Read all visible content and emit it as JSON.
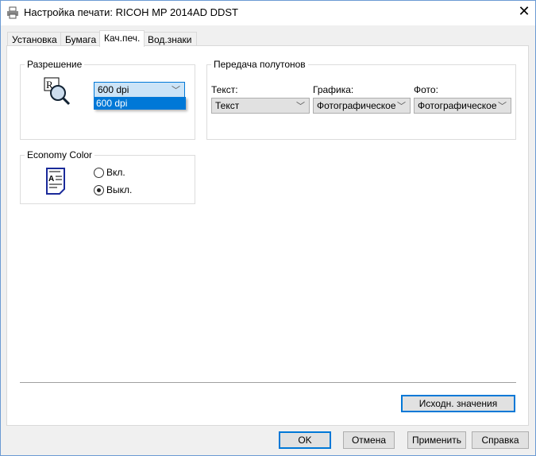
{
  "window": {
    "title": "Настройка печати: RICOH MP 2014AD DDST",
    "close": "✕"
  },
  "tabs": [
    {
      "label": "Установка"
    },
    {
      "label": "Бумага"
    },
    {
      "label": "Кач.печ.",
      "selected": true
    },
    {
      "label": "Вод.знаки"
    }
  ],
  "resolution": {
    "legend": "Разрешение",
    "value": "600 dpi",
    "options": [
      "600 dpi"
    ]
  },
  "halftone": {
    "legend": "Передача полутонов",
    "text": {
      "label": "Текст:",
      "value": "Текст"
    },
    "graphics": {
      "label": "Графика:",
      "value": "Фотографическое"
    },
    "photo": {
      "label": "Фото:",
      "value": "Фотографическое"
    }
  },
  "economy": {
    "legend": "Economy Color",
    "on": "Вкл.",
    "off": "Выкл.",
    "selected": "off"
  },
  "buttons": {
    "reset": "Исходн. значения",
    "ok": "OK",
    "cancel": "Отмена",
    "apply": "Применить",
    "help": "Справка"
  }
}
